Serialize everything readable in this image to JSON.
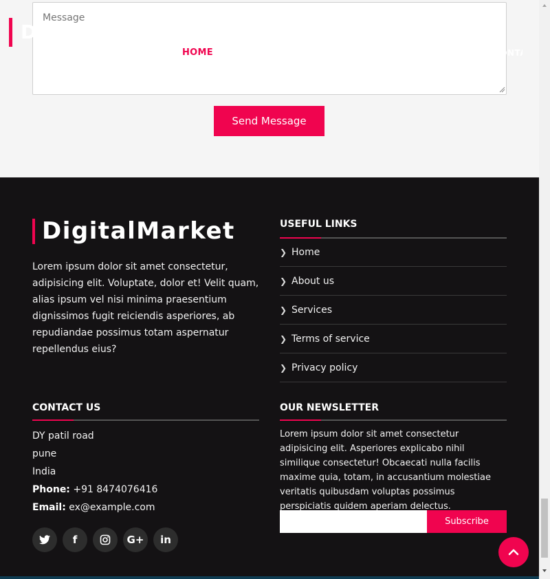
{
  "contact_form": {
    "message_placeholder": "Message",
    "send_label": "Send Message"
  },
  "navbar": {
    "logo_fragment": "D",
    "home_label": "HOME",
    "contact_fragment": "CONTACT"
  },
  "footer": {
    "brand": "DigitalMarket",
    "about": "Lorem ipsum dolor sit amet consectetur, adipisicing elit. Voluptate, dolor et! Velit quam, alias ipsum vel nisi minima praesentium dignissimos fugit reiciendis asperiores, ab repudiandae possimus totam aspernatur repellendus eius?",
    "useful_links": {
      "title": "USEFUL LINKS",
      "items": [
        "Home",
        "About us",
        "Services",
        "Terms of service",
        "Privacy policy"
      ]
    },
    "contact": {
      "title": "CONTACT US",
      "address_line1": "DY patil road",
      "address_line2": "pune",
      "address_line3": "India",
      "phone_label": "Phone:",
      "phone": "+91 8474076416",
      "email_label": "Email:",
      "email": "ex@example.com"
    },
    "socials": [
      {
        "name": "twitter-icon",
        "glyph": "🐦"
      },
      {
        "name": "facebook-icon",
        "glyph": "f"
      },
      {
        "name": "instagram-icon",
        "glyph": "◎"
      },
      {
        "name": "google-plus-icon",
        "glyph": "G+"
      },
      {
        "name": "linkedin-icon",
        "glyph": "in"
      }
    ],
    "newsletter": {
      "title": "OUR NEWSLETTER",
      "text": "Lorem ipsum dolor sit amet consectetur adipisicing elit. Asperiores explicabo nihil similique consectetur! Obcaecati nulla facilis maxime quia, totam, in accusantium molestiae veritatis quibusdam voluptas possimus perspiciatis quidem aperiam delectus.",
      "subscribe_label": "Subscribe"
    }
  },
  "colors": {
    "accent": "#f0044f",
    "footer_bg": "#141214",
    "page_bg": "#f5f5f5"
  }
}
